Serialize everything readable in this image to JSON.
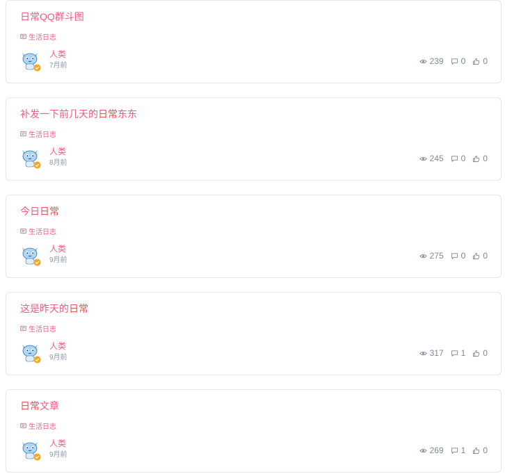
{
  "posts": [
    {
      "title_pre": "日常QQ群斗图",
      "title_hl": "",
      "title_post": "",
      "category": "生活日志",
      "author": "人类",
      "time": "7月前",
      "views": "239",
      "comments": "0",
      "likes": "0"
    },
    {
      "title_pre": "补发一下前几天的",
      "title_hl": "日常",
      "title_post": "东东",
      "category": "生活日志",
      "author": "人类",
      "time": "8月前",
      "views": "245",
      "comments": "0",
      "likes": "0"
    },
    {
      "title_pre": "今日",
      "title_hl": "日常",
      "title_post": "",
      "category": "生活日志",
      "author": "人类",
      "time": "9月前",
      "views": "275",
      "comments": "0",
      "likes": "0"
    },
    {
      "title_pre": "这是昨天的",
      "title_hl": "日常",
      "title_post": "",
      "category": "生活日志",
      "author": "人类",
      "time": "9月前",
      "views": "317",
      "comments": "1",
      "likes": "0"
    },
    {
      "title_pre": "",
      "title_hl": "日常",
      "title_post": "文章",
      "category": "生活日志",
      "author": "人类",
      "time": "9月前",
      "views": "269",
      "comments": "1",
      "likes": "0"
    }
  ],
  "icons": {
    "category": "category-icon",
    "views": "eye-icon",
    "comments": "comment-icon",
    "likes": "thumbs-up-icon",
    "verified": "verified-badge-icon"
  },
  "colors": {
    "accent": "#f25a83",
    "highlight": "#ef4f4f",
    "muted": "#8a94a6",
    "border": "#e3e6ea",
    "verified": "#f5a623"
  }
}
